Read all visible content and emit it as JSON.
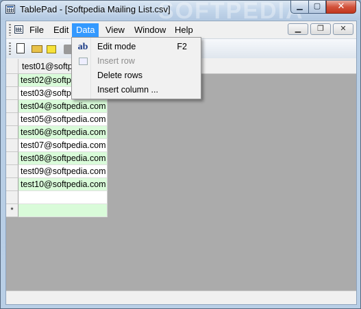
{
  "window": {
    "title": "TablePad - [Softpedia Mailing List.csv]",
    "watermark": "SOFTPEDIA",
    "minimize_glyph": "▁",
    "maximize_glyph": "▢",
    "close_glyph": "✕"
  },
  "menubar": {
    "items": [
      "File",
      "Edit",
      "Data",
      "View",
      "Window",
      "Help"
    ],
    "active_index": 2,
    "mdi_min": "▁",
    "mdi_restore": "❐",
    "mdi_close": "✕"
  },
  "toolbar": {
    "buttons": [
      "new-icon",
      "open-icon",
      "save-icon",
      "disabled-icon"
    ]
  },
  "grid": {
    "column_header": "test01@softpedia.com",
    "rows": [
      {
        "value": "test02@softpedia.com",
        "style": "alt"
      },
      {
        "value": "test03@softpedia.com",
        "style": "plain"
      },
      {
        "value": "test04@softpedia.com",
        "style": "alt"
      },
      {
        "value": "test05@softpedia.com",
        "style": "plain"
      },
      {
        "value": "test06@softpedia.com",
        "style": "alt"
      },
      {
        "value": "test07@softpedia.com",
        "style": "plain"
      },
      {
        "value": "test08@softpedia.com",
        "style": "alt"
      },
      {
        "value": "test09@softpedia.com",
        "style": "plain"
      },
      {
        "value": "test10@softpedia.com",
        "style": "alt"
      },
      {
        "value": "",
        "style": "blank"
      }
    ],
    "new_row_marker": "*"
  },
  "data_menu": {
    "items": [
      {
        "label": "Edit mode",
        "shortcut": "F2",
        "icon": "ab-icon",
        "disabled": false
      },
      {
        "label": "Insert row",
        "shortcut": "",
        "icon": "insert-row-icon",
        "disabled": true
      },
      {
        "label": "Delete rows",
        "shortcut": "",
        "icon": "",
        "disabled": false
      },
      {
        "label": "Insert column ...",
        "shortcut": "",
        "icon": "",
        "disabled": false
      }
    ]
  },
  "colors": {
    "menu_highlight": "#3399ff",
    "alt_row": "#d9fbd9"
  }
}
